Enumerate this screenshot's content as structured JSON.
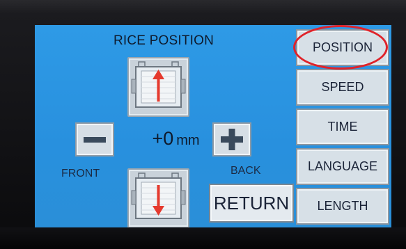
{
  "screen": {
    "title": "RICE POSITION",
    "value": "+0",
    "unit": "mm",
    "front_label": "FRONT",
    "back_label": "BACK",
    "return_label": "RETURN",
    "bg_color": "#2e9ae6",
    "arrow_color": "#e53a2e"
  },
  "menu": {
    "items": [
      {
        "label": "POSITION"
      },
      {
        "label": "SPEED"
      },
      {
        "label": "TIME"
      },
      {
        "label": "LANGUAGE"
      },
      {
        "label": "LENGTH"
      }
    ],
    "highlighted": "POSITION",
    "highlight_color": "#e0232a"
  },
  "icons": {
    "up": "arrow-up-tray-icon",
    "down": "arrow-down-tray-icon",
    "minus": "minus-icon",
    "plus": "plus-icon"
  }
}
